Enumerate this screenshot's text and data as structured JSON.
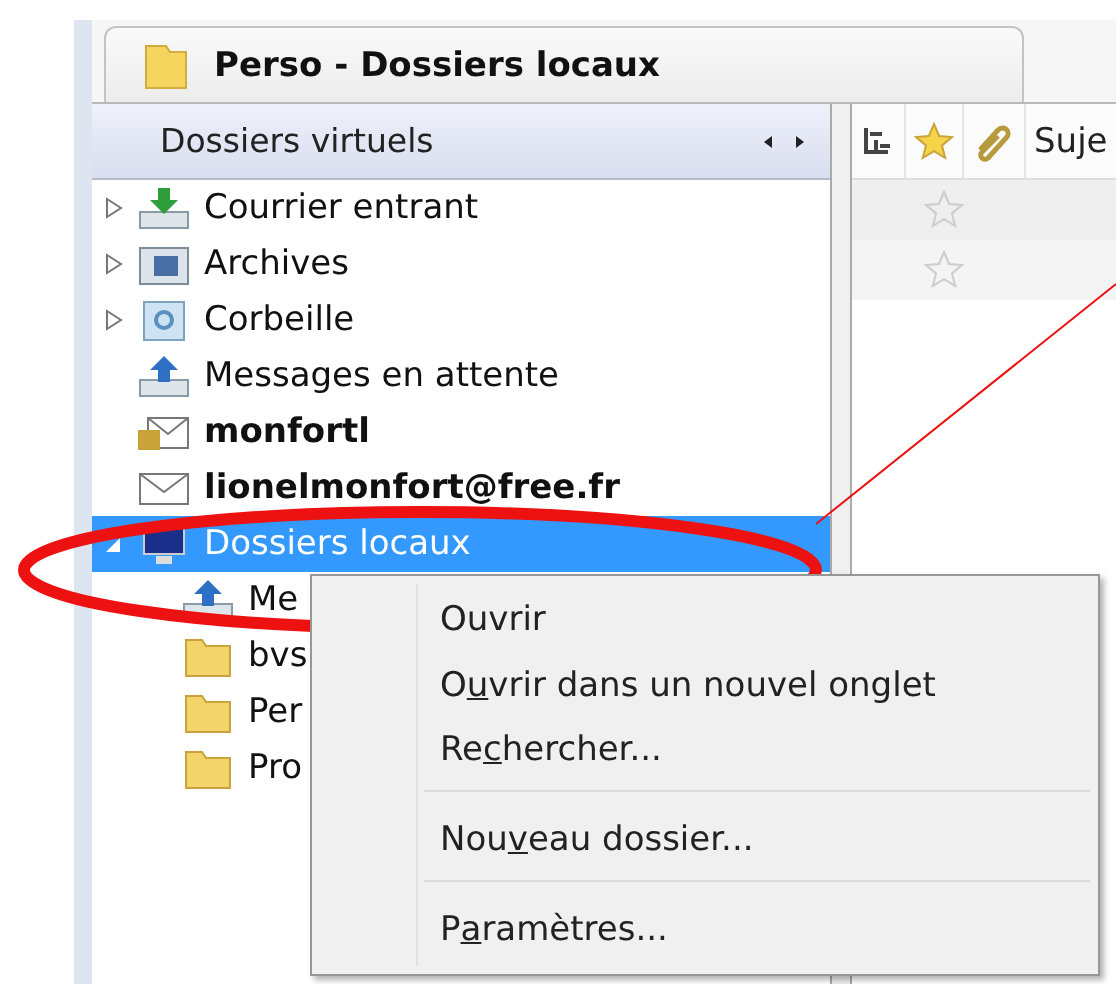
{
  "tab": {
    "title": "Perso - Dossiers locaux",
    "selected": true
  },
  "folder_pane": {
    "header": "Dossiers virtuels"
  },
  "folders": [
    {
      "label": "Courrier entrant",
      "kind": "inbox",
      "selected": false,
      "expanded": false
    },
    {
      "label": "Archives",
      "kind": "archive",
      "selected": false,
      "expanded": false
    },
    {
      "label": "Corbeille",
      "kind": "trash",
      "selected": false,
      "expanded": false
    },
    {
      "label": "Messages en attente",
      "kind": "outbox",
      "selected": false
    },
    {
      "label": "monfortl",
      "kind": "locked-account",
      "selected": false
    },
    {
      "label": "lionelmonfort@free.fr",
      "kind": "account",
      "selected": false
    },
    {
      "label": "Dossiers locaux",
      "kind": "local",
      "selected": true,
      "expanded": true,
      "children": [
        {
          "label": "Me",
          "kind": "outbox"
        },
        {
          "label": "bvs",
          "kind": "folder"
        },
        {
          "label": "Per",
          "kind": "folder"
        },
        {
          "label": "Pro",
          "kind": "folder"
        }
      ]
    }
  ],
  "message_pane": {
    "columns": [
      {
        "kind": "thread"
      },
      {
        "kind": "star"
      },
      {
        "kind": "attachment"
      },
      {
        "kind": "text",
        "label": "Suje"
      }
    ],
    "rows": [
      {
        "starred": false
      },
      {
        "starred": false
      }
    ]
  },
  "context_menu": [
    {
      "kind": "item",
      "text_before": "Ouvrir"
    },
    {
      "kind": "item",
      "text_before": "O",
      "access_key": "u",
      "text_after": "vrir dans un nouvel onglet"
    },
    {
      "kind": "item",
      "text_before": "Re",
      "access_key": "c",
      "text_after": "hercher..."
    },
    {
      "kind": "separator"
    },
    {
      "kind": "item",
      "text_before": "Nou",
      "access_key": "v",
      "text_after": "eau dossier..."
    },
    {
      "kind": "separator"
    },
    {
      "kind": "item",
      "text_before": "P",
      "access_key": "a",
      "text_after": "ramètres..."
    }
  ]
}
